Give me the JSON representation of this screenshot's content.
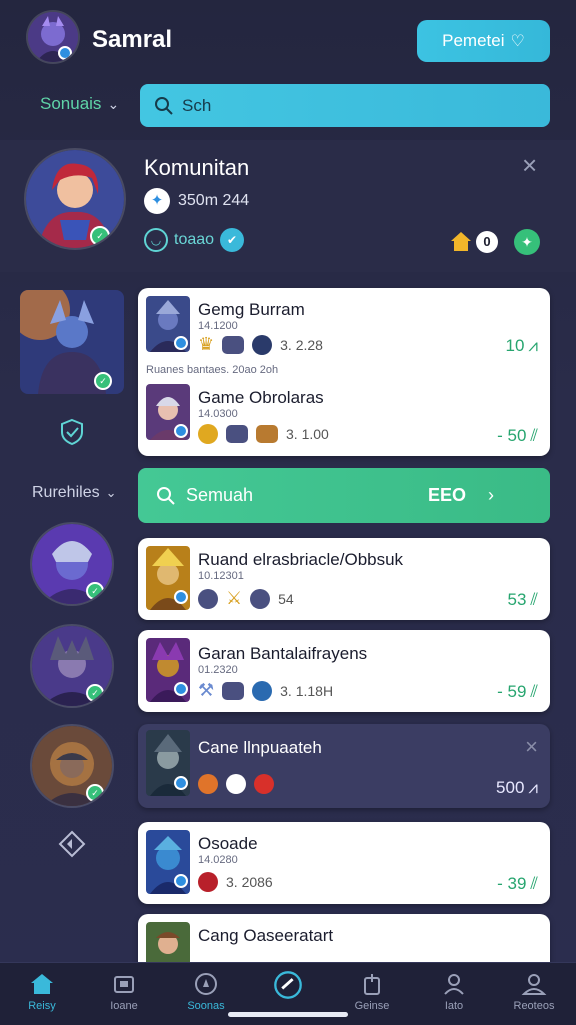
{
  "header": {
    "username": "Samral",
    "action_button": "Pemetei"
  },
  "filter_bar": {
    "dropdown_label": "Sonuais",
    "search_placeholder": "Sch"
  },
  "community": {
    "title": "Komunitan",
    "stat_line": "350m  244",
    "tag_label": "toaao",
    "home_count": "0"
  },
  "section2": {
    "dropdown_label": "Rurehiles",
    "search_label": "Semuah",
    "search_value": "EEO"
  },
  "games": [
    {
      "title": "Gemg Burram",
      "sub": "14.1200",
      "meta": "3. 2.28",
      "value": "10",
      "dark": false
    },
    {
      "title": "Game Obrolaras",
      "sub": "14.0300",
      "meta": "3. 1.00",
      "value": "- 50",
      "dark": false,
      "top_note": "Ruanes bantaes. 20ao 2oh"
    },
    {
      "title": "Ruand elrasbriacle/Obbsuk",
      "sub": "10.12301",
      "meta": "54",
      "value": "53",
      "dark": false
    },
    {
      "title": "Garan Bantalaifrayens",
      "sub": "01.2320",
      "meta": "3. 1.18H",
      "value": "- 59",
      "dark": false
    },
    {
      "title": "Cane llnpuaateh",
      "sub": "",
      "meta": "",
      "value": "500",
      "dark": true
    },
    {
      "title": "Osoade",
      "sub": "14.0280",
      "meta": "3. 2086",
      "value": "- 39",
      "dark": false
    },
    {
      "title": "Cang Oaseeratart",
      "sub": "",
      "meta": "",
      "value": "",
      "dark": false
    }
  ],
  "tabbar": [
    {
      "label": "Reisy",
      "icon": "home-icon",
      "active": true
    },
    {
      "label": "Ioane",
      "icon": "card-icon",
      "active": false
    },
    {
      "label": "Soonas",
      "icon": "compass-icon",
      "active": true
    },
    {
      "label": "",
      "icon": "check-circle-icon",
      "active": true
    },
    {
      "label": "Geinse",
      "icon": "bag-icon",
      "active": false
    },
    {
      "label": "Iato",
      "icon": "person-icon",
      "active": false
    },
    {
      "label": "Reoteos",
      "icon": "profile-icon",
      "active": false
    }
  ],
  "colors": {
    "accent_cyan": "#2fb4d6",
    "accent_green": "#3ac48a",
    "value_green": "#27a56f"
  }
}
